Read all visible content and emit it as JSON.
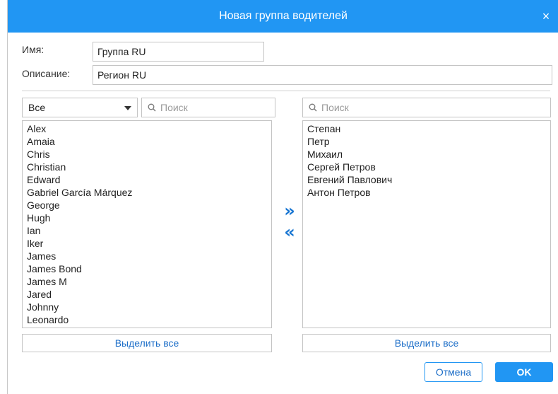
{
  "dialog": {
    "title": "Новая группа водителей",
    "close_glyph": "×"
  },
  "form": {
    "name_label": "Имя:",
    "name_value": "Группа RU",
    "description_label": "Описание:",
    "description_value": "Регион RU"
  },
  "left": {
    "filter_value": "Все",
    "search_placeholder": "Поиск",
    "items": [
      "Alex",
      "Amaia",
      "Chris",
      "Christian",
      "Edward",
      "Gabriel García Márquez",
      "George",
      "Hugh",
      "Ian",
      "Iker",
      "James",
      "James Bond",
      "James M",
      "Jared",
      "Johnny",
      "Leonardo"
    ],
    "select_all_label": "Выделить все"
  },
  "transfer": {
    "add_glyph": "»",
    "remove_glyph": "«"
  },
  "right": {
    "search_placeholder": "Поиск",
    "items": [
      "Степан",
      "Петр",
      "Михаил",
      "Сергей Петров",
      "Евгений Павлович",
      "Антон Петров"
    ],
    "select_all_label": "Выделить все"
  },
  "footer": {
    "cancel_label": "Отмена",
    "ok_label": "OK"
  },
  "colors": {
    "accent": "#2196f3",
    "link": "#1e6fc8"
  }
}
